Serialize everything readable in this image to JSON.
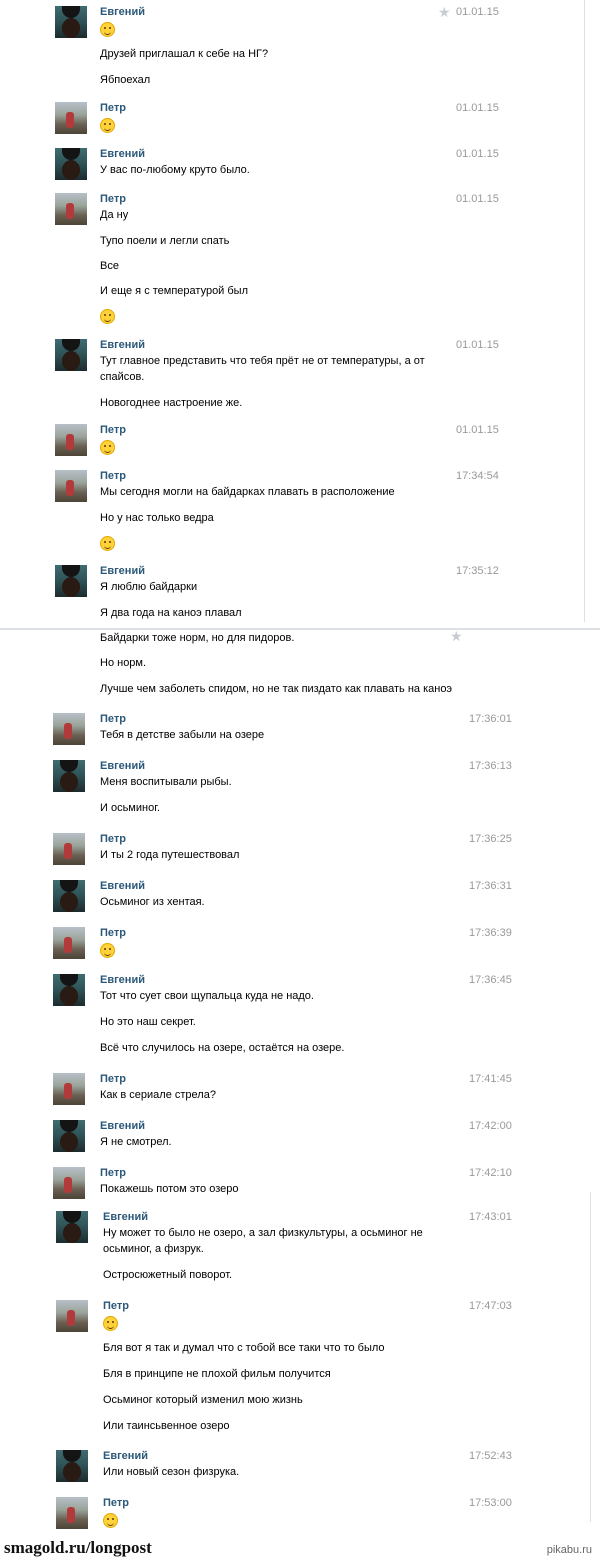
{
  "footer": {
    "left": "smagold.ru/longpost",
    "right": "pikabu.ru"
  },
  "messages": [
    {
      "author": "Евгений",
      "time": "01.01.15",
      "lines": [
        "__E",
        "Друзей приглашал к себе на НГ?",
        "Ябпоехал"
      ]
    },
    {
      "author": "Петр",
      "time": "01.01.15",
      "lines": [
        "__E"
      ]
    },
    {
      "author": "Евгений",
      "time": "01.01.15",
      "lines": [
        "У вас по-любому круто было."
      ]
    },
    {
      "author": "Петр",
      "time": "01.01.15",
      "lines": [
        "Да ну",
        "Тупо поели и легли спать",
        "Все",
        "И еще я с температурой был",
        "__E"
      ]
    },
    {
      "author": "Евгений",
      "time": "01.01.15",
      "lines": [
        "Тут главное представить что тебя прёт не от температуры, а от",
        "спайсов.",
        "Новогоднее настроение же."
      ]
    },
    {
      "author": "Петр",
      "time": "01.01.15",
      "lines": [
        "__E"
      ]
    },
    {
      "author": "Петр",
      "time": "17:34:54",
      "lines": [
        "Мы сегодня могли на байдарках плавать в расположение",
        "Но у нас только ведра",
        "__E"
      ]
    },
    {
      "author": "Евгений",
      "time": "17:35:12",
      "lines": [
        "Я люблю байдарки",
        "Я два года на каноэ плавал",
        "Байдарки тоже норм, но для пидоров.",
        "Но норм.",
        "Лучше чем заболеть спидом, но не так пиздато как плавать на каноэ"
      ]
    },
    {
      "author": "Петр",
      "time": "17:36:01",
      "lines": [
        "Тебя в детстве забыли на озере"
      ]
    },
    {
      "author": "Евгений",
      "time": "17:36:13",
      "lines": [
        "Меня воспитывали рыбы.",
        "И осьминог."
      ]
    },
    {
      "author": "Петр",
      "time": "17:36:25",
      "lines": [
        "И ты 2 года путешествовал"
      ]
    },
    {
      "author": "Евгений",
      "time": "17:36:31",
      "lines": [
        "Осьминог из хентая."
      ]
    },
    {
      "author": "Петр",
      "time": "17:36:39",
      "lines": [
        "__E"
      ]
    },
    {
      "author": "Евгений",
      "time": "17:36:45",
      "lines": [
        "Тот что сует свои щупальца куда не надо.",
        "Но это наш секрет.",
        "Всё что случилось на озере, остаётся на озере."
      ]
    },
    {
      "author": "Петр",
      "time": "17:41:45",
      "lines": [
        "Как в сериале стрела?"
      ]
    },
    {
      "author": "Евгений",
      "time": "17:42:00",
      "lines": [
        "Я не смотрел."
      ]
    },
    {
      "author": "Петр",
      "time": "17:42:10",
      "lines": [
        "Покажешь потом это озеро"
      ]
    },
    {
      "author": "Евгений",
      "time": "17:43:01",
      "lines": [
        "Ну может то было не озеро, а зал физкультуры, а осьминог не",
        "осьминог, а физрук.",
        "Остросюжетный поворот."
      ]
    },
    {
      "author": "Петр",
      "time": "17:47:03",
      "lines": [
        "__E",
        "Бля вот я так и думал что с тобой все таки что то было",
        "Бля в принципе не плохой фильм получится",
        "Осьминог который изменил мою жизнь",
        "Или таинсьвенное озеро"
      ]
    },
    {
      "author": "Евгений",
      "time": "17:52:43",
      "lines": [
        "Или новый сезон физрука."
      ]
    },
    {
      "author": "Петр",
      "time": "17:53:00",
      "lines": [
        "__E"
      ]
    }
  ]
}
